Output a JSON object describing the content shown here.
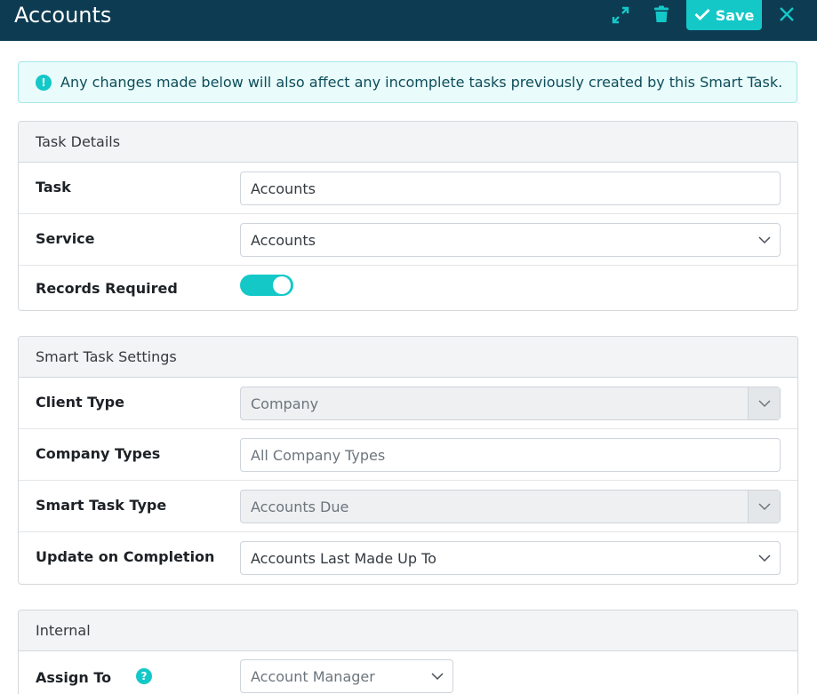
{
  "header": {
    "title": "Accounts",
    "save_label": "Save",
    "accent_color": "#14c8c8",
    "bar_color": "#0d3b52",
    "icons": [
      "expand-icon",
      "trash-icon",
      "check-icon",
      "close-icon"
    ]
  },
  "alert": {
    "icon": "!",
    "text": "Any changes made below will also affect any incomplete tasks previously created by this Smart Task."
  },
  "task_details": {
    "heading": "Task Details",
    "task_label": "Task",
    "task_value": "Accounts",
    "service_label": "Service",
    "service_value": "Accounts",
    "records_label": "Records Required",
    "records_required": true
  },
  "smart_task": {
    "heading": "Smart Task Settings",
    "client_type_label": "Client Type",
    "client_type_value": "Company",
    "company_types_label": "Company Types",
    "company_types_placeholder": "All Company Types",
    "smart_task_type_label": "Smart Task Type",
    "smart_task_type_value": "Accounts Due",
    "update_label": "Update on Completion",
    "update_value": "Accounts Last Made Up To"
  },
  "internal": {
    "heading": "Internal",
    "assign_label": "Assign To",
    "help_icon": "?",
    "assign_value": "Account Manager"
  }
}
